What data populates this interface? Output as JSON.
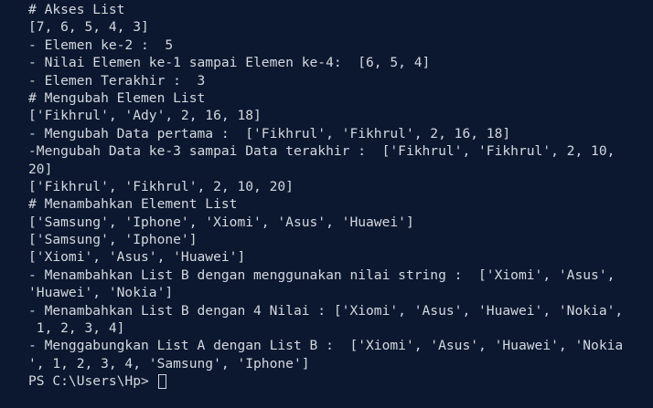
{
  "theme": {
    "background": "#0b1830",
    "foreground": "#d4d8de"
  },
  "terminal": {
    "lines": [
      "# Akses List",
      "[7, 6, 5, 4, 3]",
      "- Elemen ke-2 :  5",
      "- Nilai Elemen ke-1 sampai Elemen ke-4:  [6, 5, 4]",
      "- Elemen Terakhir :  3",
      "# Mengubah Elemen List",
      "['Fikhrul', 'Ady', 2, 16, 18]",
      "- Mengubah Data pertama :  ['Fikhrul', 'Fikhrul', 2, 16, 18]",
      "-Mengubah Data ke-3 sampai Data terakhir :  ['Fikhrul', 'Fikhrul', 2, 10,",
      "20]",
      "['Fikhrul', 'Fikhrul', 2, 10, 20]",
      "# Menambahkan Element List",
      "['Samsung', 'Iphone', 'Xiomi', 'Asus', 'Huawei']",
      "['Samsung', 'Iphone']",
      "['Xiomi', 'Asus', 'Huawei']",
      "- Menambahkan List B dengan menggunakan nilai string :  ['Xiomi', 'Asus',",
      "'Huawei', 'Nokia']",
      "- Menambahkan List B dengan 4 Nilai : ['Xiomi', 'Asus', 'Huawei', 'Nokia',",
      " 1, 2, 3, 4]",
      "- Menggabungkan List A dengan List B :  ['Xiomi', 'Asus', 'Huawei', 'Nokia",
      "', 1, 2, 3, 4, 'Samsung', 'Iphone']"
    ],
    "prompt": "PS C:\\Users\\Hp> "
  }
}
